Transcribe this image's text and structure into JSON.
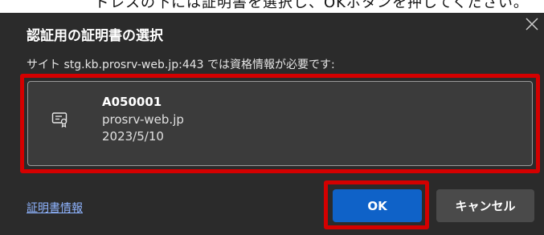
{
  "page_caption": "ドレスの下には証明書を選択し、OKボタンを押してください。",
  "dialog": {
    "title": "認証用の証明書の選択",
    "subtitle": "サイト stg.kb.prosrv-web.jp:443 では資格情報が必要です:",
    "close_icon": "close-icon",
    "certificate": {
      "icon": "certificate-icon",
      "name": "A050001",
      "issuer": "prosrv-web.jp",
      "date": "2023/5/10"
    },
    "certificate_info_link": "証明書情報",
    "ok_label": "OK",
    "cancel_label": "キャンセル"
  },
  "colors": {
    "dialog_background": "#2b2b2b",
    "card_background": "#3b3b3b",
    "primary_button": "#0f62c8",
    "secondary_button": "#4a4a4a",
    "highlight": "#d40000",
    "link": "#8fb4ff"
  }
}
